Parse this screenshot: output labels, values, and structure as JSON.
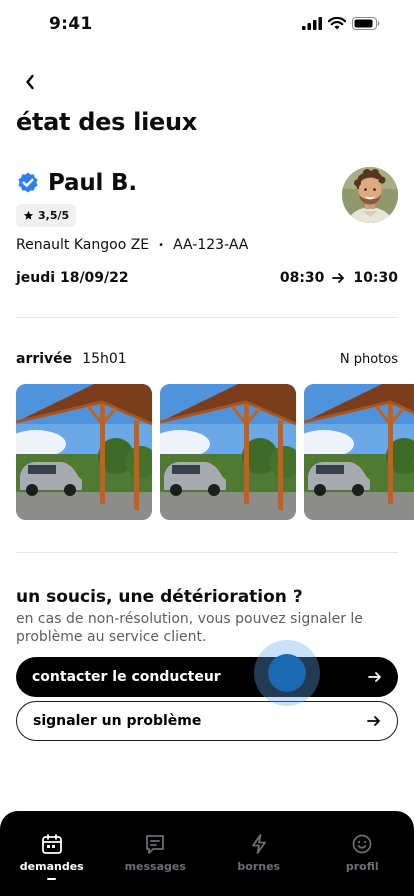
{
  "status_bar": {
    "time": "9:41"
  },
  "page": {
    "title": "état des lieux"
  },
  "driver": {
    "name": "Paul B.",
    "rating": "3,5/5"
  },
  "vehicle": {
    "model": "Renault Kangoo ZE",
    "separator": "•",
    "plate": "AA-123-AA"
  },
  "booking": {
    "date": "jeudi 18/09/22",
    "start_time": "08:30",
    "end_time": "10:30"
  },
  "arrival": {
    "label": "arrivée",
    "time": "15h01",
    "photo_count": "N photos"
  },
  "issue": {
    "title": "un soucis, une détérioration ?",
    "description": "en cas de non-résolution, vous pouvez signaler le problème au service client.",
    "contact_button": "contacter le conducteur",
    "report_button": "signaler un problème"
  },
  "tab_bar": {
    "items": [
      {
        "label": "demandes",
        "icon": "calendar-icon",
        "active": true
      },
      {
        "label": "messages",
        "icon": "message-icon",
        "active": false
      },
      {
        "label": "bornes",
        "icon": "bolt-icon",
        "active": false
      },
      {
        "label": "profil",
        "icon": "smiley-icon",
        "active": false
      }
    ]
  },
  "colors": {
    "accent_blue": "#1b68b3",
    "verified_blue": "#2e7ff0",
    "dark": "#000000",
    "muted_text": "#5b5e63"
  }
}
